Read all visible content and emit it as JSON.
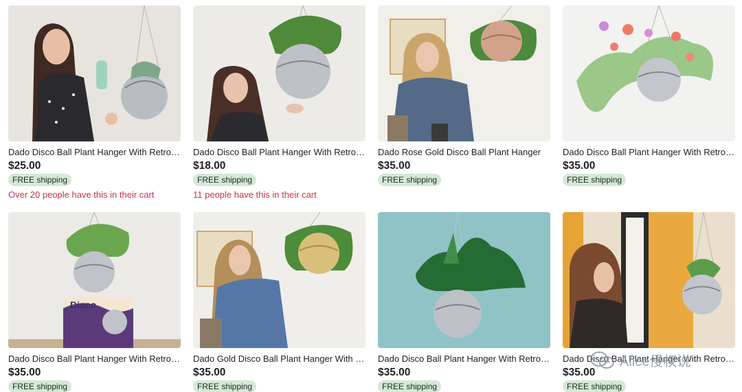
{
  "listings": [
    {
      "title": "Dado Disco Ball Plant Hanger With Retro Style",
      "price": "$25.00",
      "shipping": "FREE shipping",
      "cart_note": "Over 20 people have this in their cart"
    },
    {
      "title": "Dado Disco Ball Plant Hanger With Retro Style",
      "price": "$18.00",
      "shipping": "FREE shipping",
      "cart_note": "11 people have this in their cart"
    },
    {
      "title": "Dado Rose Gold Disco Ball Plant Hanger",
      "price": "$35.00",
      "shipping": "FREE shipping"
    },
    {
      "title": "Dado Disco Ball Plant Hanger With Retro Style",
      "price": "$35.00",
      "shipping": "FREE shipping"
    },
    {
      "title": "Dado Disco Ball Plant Hanger With Retro Style",
      "price": "$35.00",
      "shipping": "FREE shipping"
    },
    {
      "title": "Dado Gold Disco Ball Plant Hanger With Retro Style",
      "price": "$35.00",
      "shipping": "FREE shipping"
    },
    {
      "title": "Dado Disco Ball Plant Hanger With Retro Style",
      "price": "$35.00",
      "shipping": "FREE shipping"
    },
    {
      "title": "Dado Disco Ball Plant Hanger With Retro Style",
      "price": "$35.00",
      "shipping": "FREE shipping"
    }
  ],
  "watermark": {
    "text": "Alice侵权说",
    "icon": "wechat-icon"
  },
  "colors": {
    "shipping_badge": "#d4e9d7",
    "cart_note": "#c8324a",
    "text": "#222222"
  }
}
